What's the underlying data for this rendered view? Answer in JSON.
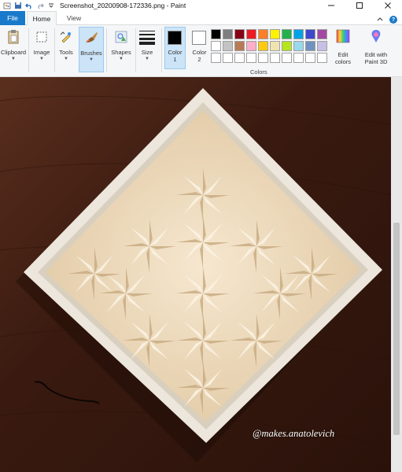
{
  "window": {
    "title": "Screenshot_20200908-172336.png - Paint",
    "controls": [
      "minimize-icon",
      "maximize-icon",
      "close-icon"
    ]
  },
  "quick_access": [
    "paint-app-icon",
    "save-icon",
    "undo-icon",
    "redo-icon",
    "customize-chevron-icon"
  ],
  "tabs": {
    "file": "File",
    "home": "Home",
    "view": "View"
  },
  "ribbon": {
    "clipboard": "Clipboard",
    "image": "Image",
    "tools": "Tools",
    "brushes": "Brushes",
    "shapes": "Shapes",
    "size": "Size",
    "color1": "Color\n1",
    "color2": "Color\n2",
    "colors_group": "Colors",
    "edit_colors": "Edit\ncolors",
    "edit_paint3d": "Edit with\nPaint 3D"
  },
  "colors": {
    "color1": "#000000",
    "color2": "#ffffff",
    "palette_row1": [
      "#000000",
      "#7f7f7f",
      "#880015",
      "#ed1c24",
      "#ff7f27",
      "#fff200",
      "#22b14c",
      "#00a2e8",
      "#3f48cc",
      "#a349a4"
    ],
    "palette_row2": [
      "#ffffff",
      "#c3c3c3",
      "#b97a57",
      "#ffaec9",
      "#ffc90e",
      "#efe4b0",
      "#b5e61d",
      "#99d9ea",
      "#7092be",
      "#c8bfe7"
    ],
    "palette_row3": [
      "#ffffff",
      "#ffffff",
      "#ffffff",
      "#ffffff",
      "#ffffff",
      "#ffffff",
      "#ffffff",
      "#ffffff",
      "#ffffff",
      "#ffffff"
    ],
    "accent": "#1979ca"
  },
  "canvas": {
    "watermark": "@makes.anatolevich"
  }
}
